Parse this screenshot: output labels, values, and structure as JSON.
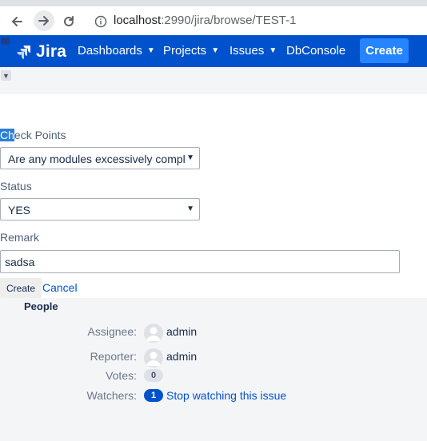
{
  "browser": {
    "url_host": "localhost",
    "url_path": ":2990/jira/browse/TEST-1"
  },
  "header": {
    "logo_text": "Jira",
    "nav": [
      "Dashboards",
      "Projects",
      "Issues",
      "DbConsole"
    ],
    "create_label": "Create",
    "brand_color": "#0052cc"
  },
  "form": {
    "checkpoints_label_highlight": "Ch",
    "checkpoints_label_rest": "eck Points",
    "checkpoints_value": "Are any modules excessively compl",
    "status_label": "Status",
    "status_value": "YES",
    "remark_label": "Remark",
    "remark_value": "sadsa",
    "create_button": "Create",
    "cancel_link": "Cancel"
  },
  "people": {
    "title": "People",
    "assignee_label": "Assignee:",
    "assignee": "admin",
    "reporter_label": "Reporter:",
    "reporter": "admin",
    "votes_label": "Votes:",
    "votes": "0",
    "watchers_label": "Watchers:",
    "watchers": "1",
    "watch_link": "Stop watching this issue"
  }
}
